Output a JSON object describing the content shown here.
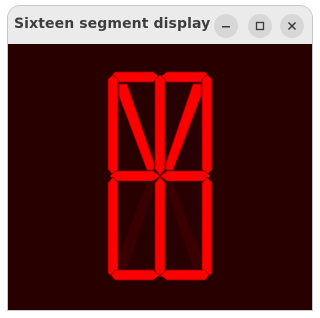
{
  "window": {
    "title": "Sixteen segment display ...",
    "controls": {
      "minimize_icon": "minimize-icon",
      "maximize_icon": "maximize-icon",
      "close_icon": "close-icon"
    }
  },
  "display": {
    "on_color": "#ff0000",
    "off_color": "#3a0000",
    "background_color": "#280000",
    "segments_lit": [
      "a1",
      "a2",
      "b",
      "c",
      "d1",
      "d2",
      "e",
      "f",
      "g1",
      "g2",
      "h",
      "i",
      "j",
      "l"
    ],
    "segments_unlit": [
      "k",
      "m"
    ]
  }
}
